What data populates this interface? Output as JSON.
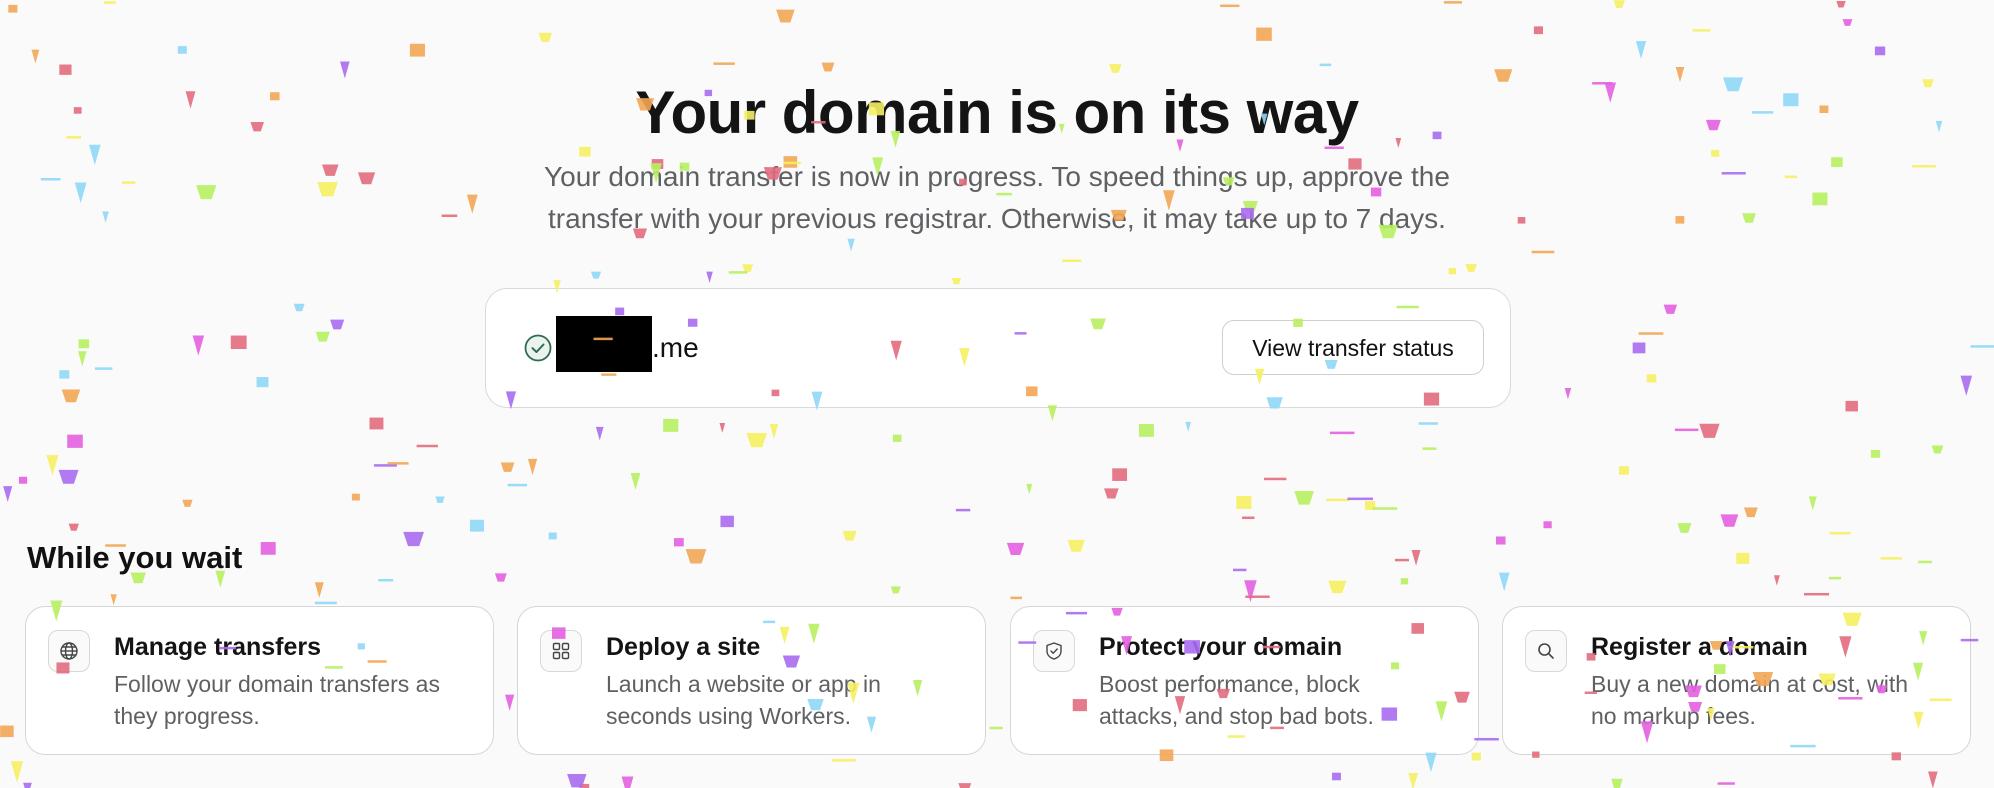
{
  "hero": {
    "title": "Your domain is on its way",
    "subtitle": "Your domain transfer is now in progress. To speed things up, approve the transfer with your previous registrar. Otherwise, it may take up to 7 days."
  },
  "domain": {
    "tld": ".me",
    "status_icon": "check-circle-icon",
    "status_button_label": "View transfer status",
    "accent_color": "#2f6b4f"
  },
  "while_you_wait": {
    "title": "While you wait",
    "cards": [
      {
        "icon": "globe-icon",
        "title": "Manage transfers",
        "description": "Follow your domain transfers as they progress."
      },
      {
        "icon": "grid-icon",
        "title": "Deploy a site",
        "description": "Launch a website or app in seconds using Workers."
      },
      {
        "icon": "shield-icon",
        "title": "Protect your domain",
        "description": "Boost performance, block attacks, and stop bad bots."
      },
      {
        "icon": "search-icon",
        "title": "Register a domain",
        "description": "Buy a new domain at cost, with no markup fees."
      }
    ]
  },
  "confetti_colors": [
    "#e26b7e",
    "#a86cf0",
    "#f2a654",
    "#8fd7f7",
    "#b8f060",
    "#f5f060",
    "#e35fe0"
  ]
}
